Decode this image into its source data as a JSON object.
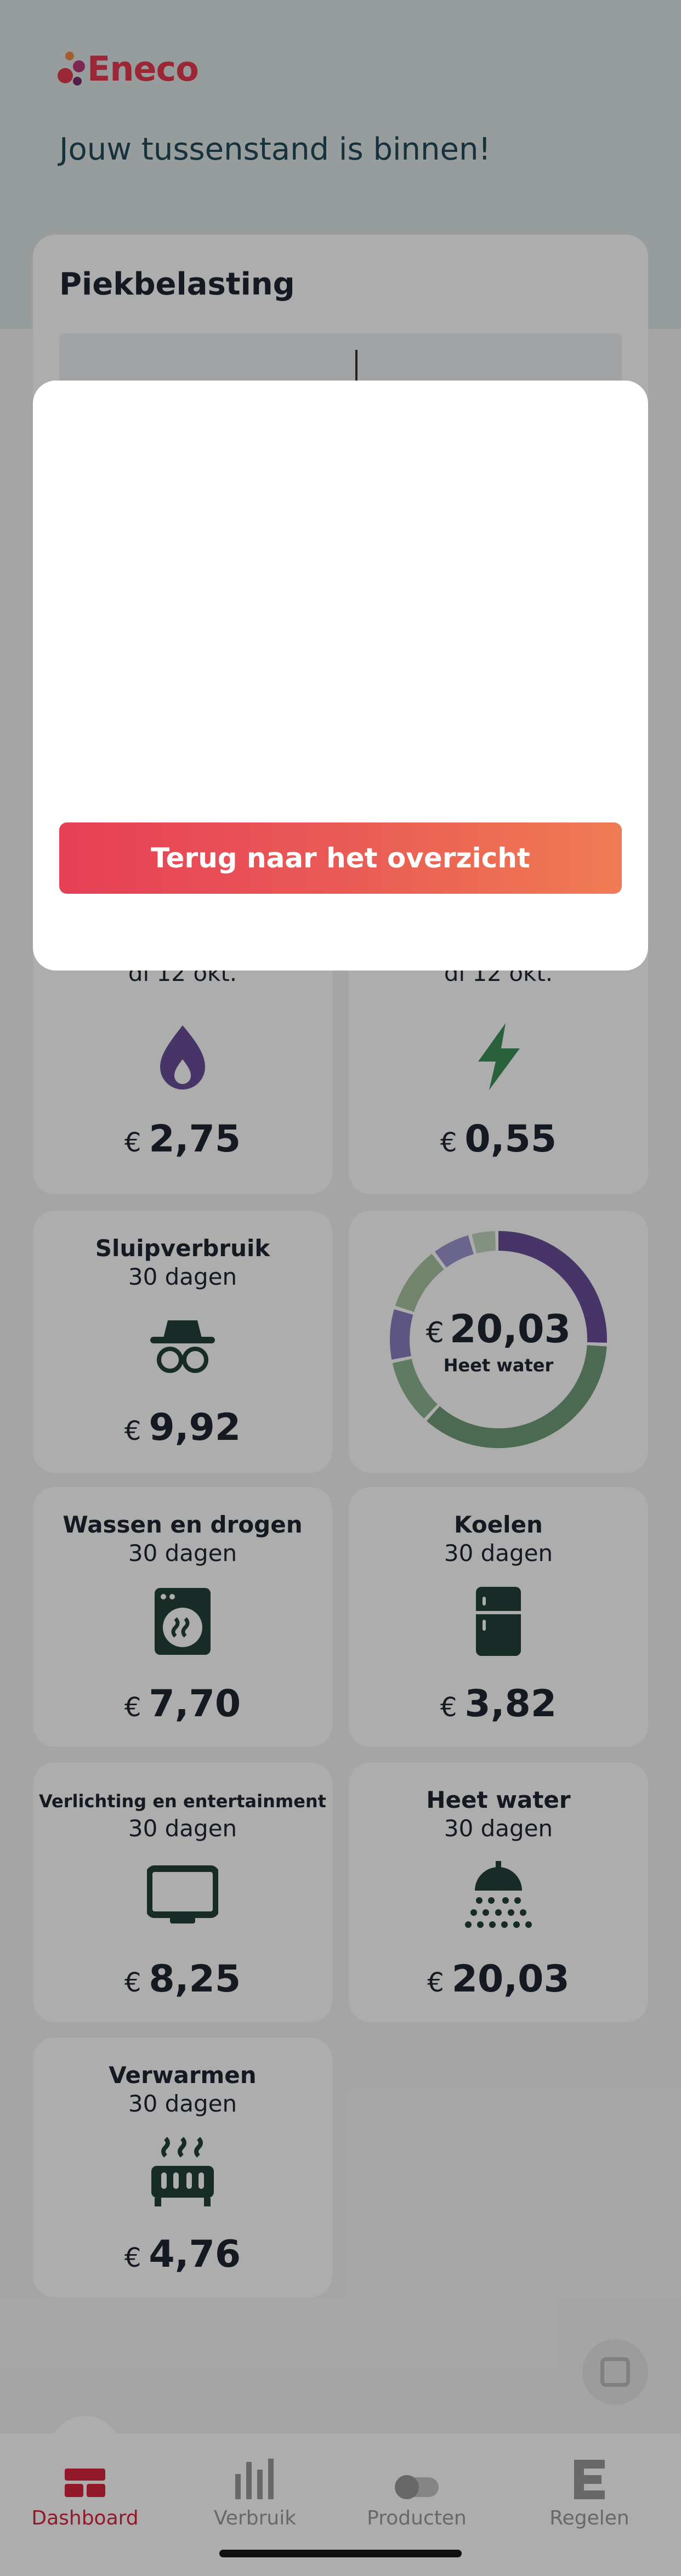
{
  "app": {
    "logo_text": "Eneco",
    "headline": "Jouw tussenstand is binnen!",
    "brand_color": "#e5384f"
  },
  "peak_card": {
    "title": "Piekbelasting"
  },
  "tiles": [
    {
      "id": "gas",
      "title": "",
      "subtitle": "di 12 okt.",
      "icon": "flame-icon",
      "currency": "€",
      "value": "2,75"
    },
    {
      "id": "stroom",
      "title": "",
      "subtitle": "di 12 okt.",
      "icon": "lightning-icon",
      "currency": "€",
      "value": "0,55"
    },
    {
      "id": "sluipverbruik",
      "title": "Sluipverbruik",
      "subtitle": "30 dagen",
      "icon": "spy-icon",
      "currency": "€",
      "value": "9,92"
    },
    {
      "id": "wassen",
      "title": "Wassen en drogen",
      "subtitle": "30 dagen",
      "icon": "washing-machine-icon",
      "currency": "€",
      "value": "7,70"
    },
    {
      "id": "koelen",
      "title": "Koelen",
      "subtitle": "30 dagen",
      "icon": "fridge-icon",
      "currency": "€",
      "value": "3,82"
    },
    {
      "id": "verlichting",
      "title": "Verlichting en entertainment",
      "subtitle": "30 dagen",
      "icon": "monitor-icon",
      "currency": "€",
      "value": "8,25"
    },
    {
      "id": "heet_water",
      "title": "Heet water",
      "subtitle": "30 dagen",
      "icon": "shower-icon",
      "currency": "€",
      "value": "20,03"
    },
    {
      "id": "verwarmen",
      "title": "Verwarmen",
      "subtitle": "30 dagen",
      "icon": "radiator-icon",
      "currency": "€",
      "value": "4,76"
    }
  ],
  "donut": {
    "currency": "€",
    "value": "20,03",
    "label": "Heet water",
    "segments": [
      {
        "share": 0.26,
        "color": "#6a4f9a"
      },
      {
        "share": 0.36,
        "color": "#6f9c78"
      },
      {
        "share": 0.1,
        "color": "#8db58f"
      },
      {
        "share": 0.08,
        "color": "#8a7fc2"
      },
      {
        "share": 0.1,
        "color": "#a8c4a0"
      },
      {
        "share": 0.06,
        "color": "#9d95cf"
      },
      {
        "share": 0.04,
        "color": "#c5d6bd"
      }
    ]
  },
  "modal": {
    "button_label": "Terug naar het overzicht"
  },
  "nav": {
    "items": [
      {
        "label": "Dashboard",
        "icon": "dashboard-icon",
        "active": true
      },
      {
        "label": "Verbruik",
        "icon": "bar-chart-icon",
        "active": false
      },
      {
        "label": "Producten",
        "icon": "toggle-icon",
        "active": false
      },
      {
        "label": "Regelen",
        "icon": "eneco-e-icon",
        "active": false
      }
    ]
  },
  "colors": {
    "icon_dark": "#23403a",
    "icon_purple": "#6a4f9a",
    "icon_green": "#3f8f5a",
    "active_nav": "#d7263e",
    "inactive_nav": "#9a9a9a"
  }
}
